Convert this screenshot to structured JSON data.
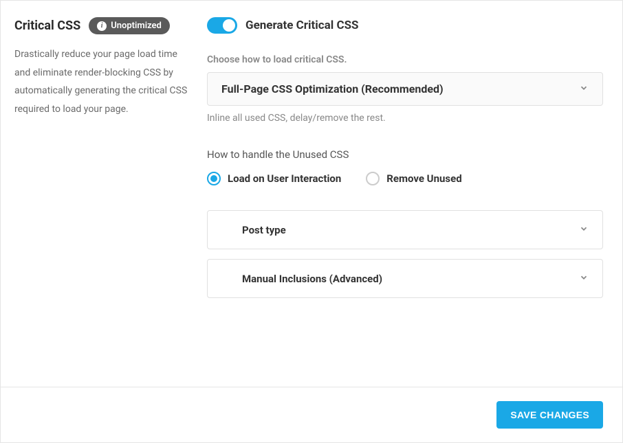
{
  "sidebar": {
    "title": "Critical CSS",
    "badge": "Unoptimized",
    "description": "Drastically reduce your page load time and eliminate render-blocking CSS by automatically generating the critical CSS required to load your page."
  },
  "settings": {
    "toggle_label": "Generate Critical CSS",
    "load_method": {
      "label": "Choose how to load critical CSS.",
      "selected": "Full-Page CSS Optimization (Recommended)",
      "helper": "Inline all used CSS, delay/remove the rest."
    },
    "unused_css": {
      "label": "How to handle the Unused CSS",
      "options": [
        {
          "label": "Load on User Interaction",
          "selected": true
        },
        {
          "label": "Remove Unused",
          "selected": false
        }
      ]
    },
    "expanders": [
      {
        "label": "Post type"
      },
      {
        "label": "Manual Inclusions (Advanced)"
      }
    ]
  },
  "footer": {
    "save_label": "SAVE CHANGES"
  }
}
